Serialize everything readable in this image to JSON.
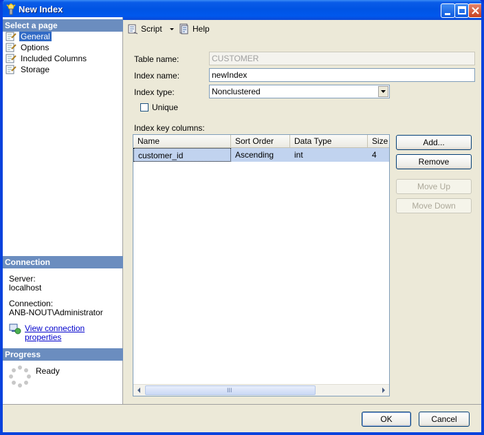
{
  "window": {
    "title": "New Index"
  },
  "left_panel": {
    "select_page_header": "Select a page",
    "pages": [
      {
        "label": "General",
        "selected": true
      },
      {
        "label": "Options",
        "selected": false
      },
      {
        "label": "Included Columns",
        "selected": false
      },
      {
        "label": "Storage",
        "selected": false
      }
    ],
    "connection_header": "Connection",
    "server_label": "Server:",
    "server_value": "localhost",
    "connection_label": "Connection:",
    "connection_value": "ANB-NOUT\\Administrator",
    "view_connection_properties": "View connection properties",
    "progress_header": "Progress",
    "progress_status": "Ready"
  },
  "toolbar": {
    "script_label": "Script",
    "help_label": "Help"
  },
  "form": {
    "table_name_label": "Table name:",
    "table_name_value": "CUSTOMER",
    "index_name_label": "Index name:",
    "index_name_value": "newIndex",
    "index_type_label": "Index type:",
    "index_type_value": "Nonclustered",
    "unique_label": "Unique",
    "unique_checked": false,
    "key_columns_label": "Index key columns:"
  },
  "grid": {
    "columns": [
      "Name",
      "Sort Order",
      "Data Type",
      "Size"
    ],
    "rows": [
      [
        "customer_id",
        "Ascending",
        "int",
        "4"
      ]
    ],
    "scroll_grip": "III"
  },
  "buttons": {
    "add": "Add...",
    "remove": "Remove",
    "move_up": "Move Up",
    "move_down": "Move Down",
    "ok": "OK",
    "cancel": "Cancel"
  },
  "colors": {
    "title_bar": "#0054e3",
    "section_header": "#6b8dbf",
    "selection": "#316ac5",
    "row_highlight": "#c1d3ef"
  }
}
